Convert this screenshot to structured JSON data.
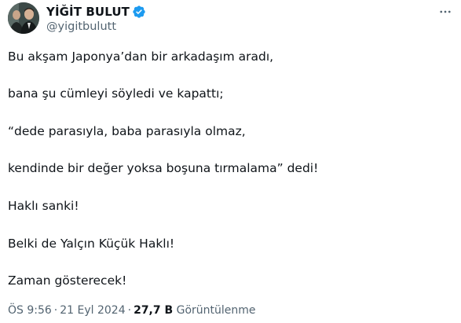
{
  "author": {
    "display_name": "YİĞİT BULUT",
    "handle": "@yigitbulutt",
    "verified_color": "#1d9bf0"
  },
  "icons": {
    "avatar": "profile-photo",
    "verified": "verified-badge-icon",
    "more": "more-horizontal-icon"
  },
  "tweet": {
    "paragraphs": [
      "Bu akşam Japonya’dan bir arkadaşım aradı,",
      "bana şu cümleyi söyledi ve kapattı;",
      " “dede parasıyla, baba parasıyla olmaz,",
      "kendinde bir değer yoksa boşuna tırmalama” dedi!",
      "Haklı sanki!",
      "Belki de Yalçın Küçük Haklı!",
      "Zaman gösterecek!"
    ]
  },
  "meta": {
    "time": "ÖS 9:56",
    "date": "21 Eyl 2024",
    "separator": "·",
    "views_count": "27,7 B",
    "views_label": "Görüntülenme"
  }
}
